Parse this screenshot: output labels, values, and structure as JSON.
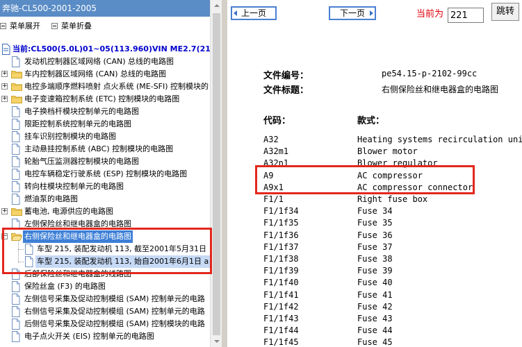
{
  "left": {
    "title": "奔驰-CL500-2001-2005",
    "toolbar": {
      "expand": "菜单展开",
      "collapse": "菜单折叠"
    },
    "tree": [
      {
        "kind": "root",
        "label": "当前:CL500(5.0L)01~05(113.960)VIN ME2.7(215"
      },
      {
        "kind": "doc",
        "label": "发动机控制器区域网络 (CAN) 总线的电路图"
      },
      {
        "kind": "folder",
        "label": "车内控制器区域网络 (CAN) 总线的电路图"
      },
      {
        "kind": "folder",
        "label": "电控多端顺序燃料喷射 点火系统 (ME-SFI) 控制模块的"
      },
      {
        "kind": "folder",
        "label": "电子变速箱控制系统 (ETC) 控制模块的电路图"
      },
      {
        "kind": "doc",
        "label": "电子换档杆模块控制单元的电路图"
      },
      {
        "kind": "doc",
        "label": "限距控制系统控制单元的电路图"
      },
      {
        "kind": "doc",
        "label": "挂车识别控制模块的电路图"
      },
      {
        "kind": "doc",
        "label": "主动悬挂控制系统 (ABC) 控制模块的电路图"
      },
      {
        "kind": "doc",
        "label": "轮胎气压监测器控制模块的电路图"
      },
      {
        "kind": "doc",
        "label": "电控车辆稳定行驶系统 (ESP) 控制模块的电路图"
      },
      {
        "kind": "doc",
        "label": "转向柱模块控制单元的电路图"
      },
      {
        "kind": "doc",
        "label": "燃油泵的电路图"
      },
      {
        "kind": "folder",
        "label": "蓄电池, 电源供应的电路图"
      },
      {
        "kind": "doc",
        "label": "左侧保险丝和继电器盒的电路图"
      },
      {
        "kind": "folder-open",
        "label": "右侧保险丝和继电器盒的电路图"
      },
      {
        "kind": "child",
        "label": "车型 215, 装配发动机 113, 截至2001年5月31日"
      },
      {
        "kind": "child-selected",
        "label": "车型 215, 装配发动机 113, 始自2001年6月1日 a"
      },
      {
        "kind": "doc",
        "label": "后部保险丝和继电器盒的线路图"
      },
      {
        "kind": "doc",
        "label": "保险丝盒 (F3) 的电路图"
      },
      {
        "kind": "doc",
        "label": "左侧信号采集及促动控制模组 (SAM) 控制单元的电路"
      },
      {
        "kind": "doc",
        "label": "右侧信号采集及促动控制模组 (SAM) 控制单元的电路"
      },
      {
        "kind": "doc",
        "label": "后侧信号采集及促动控制模组 (SAM) 控制模块的电路"
      },
      {
        "kind": "doc",
        "label": "电子点火开关 (EIS) 控制单元的电路图"
      }
    ]
  },
  "nav": {
    "prev": "上一页",
    "next": "下一页",
    "page_label": "当前为",
    "page_value": "221",
    "jump": "跳转"
  },
  "doc": {
    "file_no_label": "文件编号：",
    "file_no": "pe54.15-p-2102-99cc",
    "file_title_label": "文件标题：",
    "file_title": "右侧保险丝和继电器盒的电路图",
    "col_code": "代码：",
    "col_desc": "款式：",
    "rows": [
      {
        "code": "A32",
        "desc": "Heating systems recirculation unit"
      },
      {
        "code": "A32m1",
        "desc": "Blower motor"
      },
      {
        "code": "A32n1",
        "desc": "Blower regulator"
      },
      {
        "code": "A9",
        "desc": "AC compressor"
      },
      {
        "code": "A9x1",
        "desc": "AC compressor connector"
      },
      {
        "code": "F1/1",
        "desc": "Right fuse box"
      },
      {
        "code": "F1/1f34",
        "desc": "Fuse 34"
      },
      {
        "code": "F1/1f35",
        "desc": "Fuse 35"
      },
      {
        "code": "F1/1f36",
        "desc": "Fuse 36"
      },
      {
        "code": "F1/1f37",
        "desc": "Fuse 37"
      },
      {
        "code": "F1/1f38",
        "desc": "Fuse 38"
      },
      {
        "code": "F1/1f39",
        "desc": "Fuse 39"
      },
      {
        "code": "F1/1f40",
        "desc": "Fuse 40"
      },
      {
        "code": "F1/1f41",
        "desc": "Fuse 41"
      },
      {
        "code": "F1/1f42",
        "desc": "Fuse 42"
      },
      {
        "code": "F1/1f43",
        "desc": "Fuse 43"
      },
      {
        "code": "F1/1f44",
        "desc": "Fuse 44"
      },
      {
        "code": "F1/1f45",
        "desc": "Fuse 45"
      }
    ]
  },
  "colors": {
    "title_bar": "#5a8cc6",
    "root_text": "#0000cc",
    "selection": "#3d7fd6",
    "annotation": "#e2271d",
    "page_label": "#e0000b"
  }
}
